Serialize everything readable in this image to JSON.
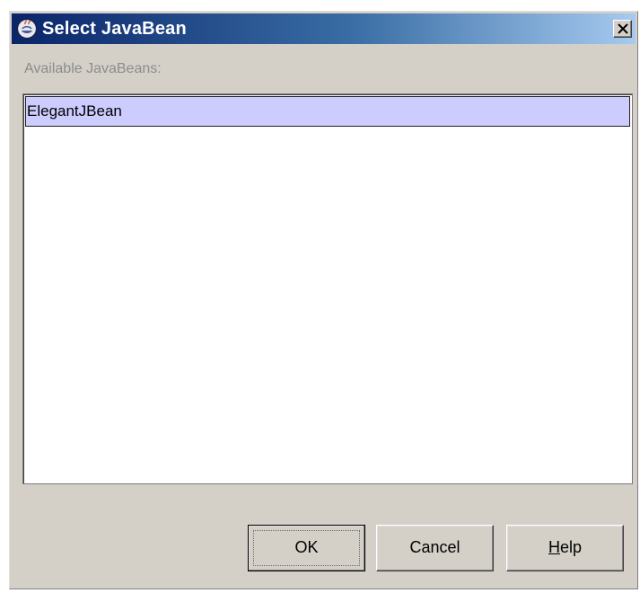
{
  "window": {
    "title": "Select JavaBean",
    "title_icon": "java-cup-icon",
    "close_icon": "close-icon"
  },
  "available": {
    "label": "Available JavaBeans:",
    "items": [
      "ElegantJBean"
    ],
    "selected": "ElegantJBean"
  },
  "buttons": {
    "ok": "OK",
    "cancel": "Cancel",
    "help_mnemonic": "H",
    "help_rest": "elp"
  },
  "colors": {
    "titlebar_start": "#0a246a",
    "titlebar_end": "#a6caf0",
    "dialog_bg": "#d4d0c8",
    "selection_bg": "#ccccff",
    "label_text": "#8c8c8c"
  }
}
